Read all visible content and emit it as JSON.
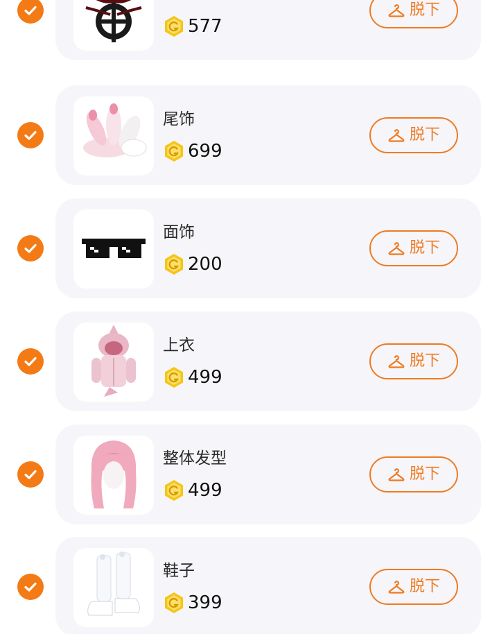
{
  "items": [
    {
      "name": "",
      "price": "577",
      "button_label": "脱下",
      "thumb_icon": "wings-emblem-icon",
      "checked": true
    },
    {
      "name": "尾饰",
      "price": "699",
      "button_label": "脱下",
      "thumb_icon": "fox-tails-icon",
      "checked": true
    },
    {
      "name": "面饰",
      "price": "200",
      "button_label": "脱下",
      "thumb_icon": "pixel-sunglasses-icon",
      "checked": true
    },
    {
      "name": "上衣",
      "price": "499",
      "button_label": "脱下",
      "thumb_icon": "shark-hoodie-icon",
      "checked": true
    },
    {
      "name": "整体发型",
      "price": "499",
      "button_label": "脱下",
      "thumb_icon": "pink-hair-icon",
      "checked": true
    },
    {
      "name": "鞋子",
      "price": "399",
      "button_label": "脱下",
      "thumb_icon": "white-boots-icon",
      "checked": true
    }
  ],
  "colors": {
    "accent": "#f47a16",
    "card_bg": "#f6f5f9",
    "coin": "#f5c518"
  }
}
